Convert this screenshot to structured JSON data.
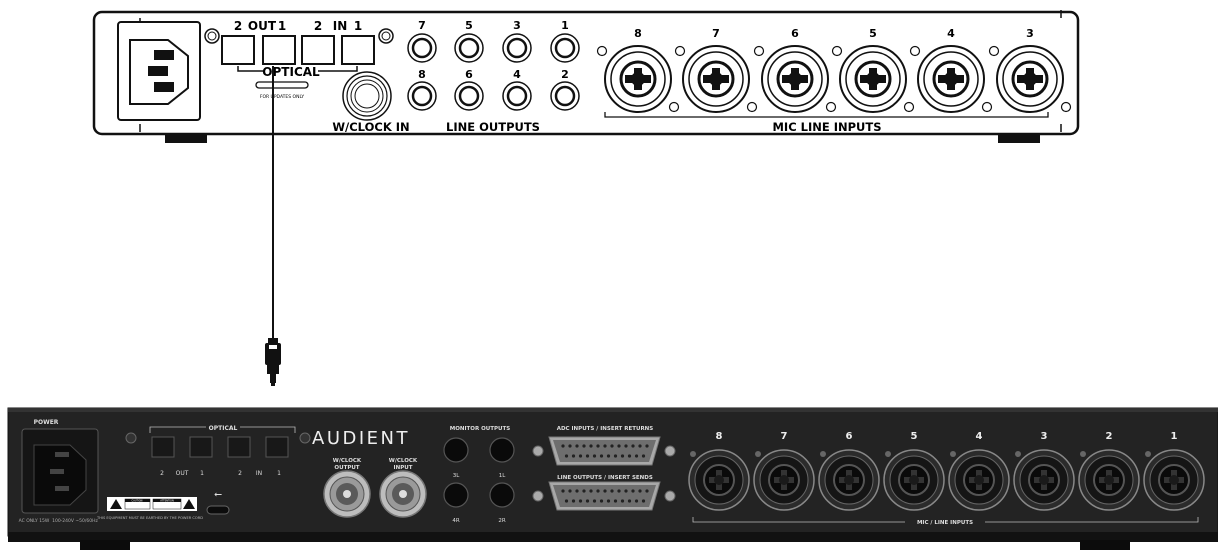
{
  "top_unit": {
    "optical_labels": {
      "out": "OUT",
      "in": "IN",
      "n2a": "2",
      "n1a": "1",
      "n2b": "2",
      "n1b": "1",
      "optical": "OPTICAL"
    },
    "usb_label": "FOR UPDATES ONLY",
    "wclock_label": "W/CLOCK IN",
    "line_out_numbers_top": [
      "7",
      "5",
      "3",
      "1"
    ],
    "line_out_numbers_bottom": [
      "8",
      "6",
      "4",
      "2"
    ],
    "line_out_label": "LINE OUTPUTS",
    "mic_numbers": [
      "8",
      "7",
      "6",
      "5",
      "4",
      "3"
    ],
    "mic_label": "MIC LINE INPUTS"
  },
  "bottom_unit": {
    "power_label": "POWER",
    "optical_label": "OPTICAL",
    "optical_numbers": [
      "2",
      "OUT",
      "1",
      "2",
      "IN",
      "1"
    ],
    "brand": "AUDIENT",
    "wclock_output": [
      "W/CLOCK",
      "OUTPUT"
    ],
    "wclock_input": [
      "W/CLOCK",
      "INPUT"
    ],
    "monitor_label": "MONITOR OUTPUTS",
    "monitor_jacks": [
      "3L",
      "1L",
      "4R",
      "2R"
    ],
    "adc_label": "ADC INPUTS  /  INSERT RETURNS",
    "line_label": "LINE OUTPUTS  /  INSERT SENDS",
    "mic_numbers": [
      "8",
      "7",
      "6",
      "5",
      "4",
      "3",
      "2",
      "1"
    ],
    "mic_label": "MIC / LINE INPUTS",
    "ac_info": "AC ONLY 15W",
    "voltage_info": "100-240V ~50/60Hz",
    "warning_text": "THIS EQUIPMENT MUST BE EARTHED BY THE POWER CORD",
    "caution": "CAUTION",
    "attention": "ATTENTION"
  }
}
